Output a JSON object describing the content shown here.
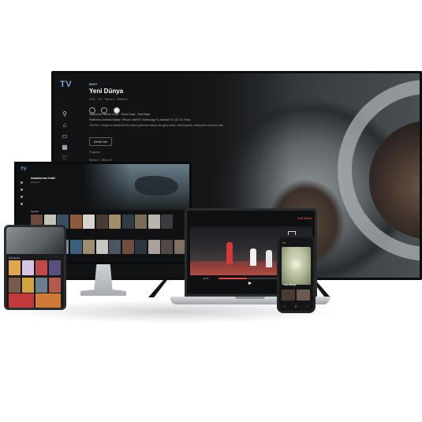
{
  "tv": {
    "logo": "TV",
    "genre": "MAVİ",
    "title": "Yeni Dünya",
    "meta": "2022 · 13+ · Sezon 1 · Bölüm 1",
    "cast": "Oyuncular: Ahmet Yıldız · Deniz Kaya · Eda Aslan",
    "platforms": "Platforms: Android Mobile, iPhone, WebTV, Samsung TV, Android TV, LG TV, Roku",
    "description": "2022'de, Dünya'nın ötesindeki ilk koloni görevine katılan bir genç kadın, bilinmeyenle yüzleşmek zorunda kalır.",
    "watch_label": "Şimdi İzle",
    "trailer_label": "Fragman",
    "seasons_label": "Sezon 1 · Bölüm 8",
    "sidebar_icons": [
      "search-icon",
      "home-icon",
      "tv-icon",
      "grid-icon",
      "heart-icon",
      "logout-icon"
    ]
  },
  "monitor": {
    "logo": "TV",
    "title": "Anadolu'nun Kalbi",
    "subtitle": "Belgesel",
    "row_label": "Popüler"
  },
  "tablet": {
    "row_label": "Önerilenler"
  },
  "laptop": {
    "brand": "Yeni Sezon",
    "time": "12:45"
  },
  "phone": {
    "header": "TV",
    "title": "Yeni Dünya"
  }
}
